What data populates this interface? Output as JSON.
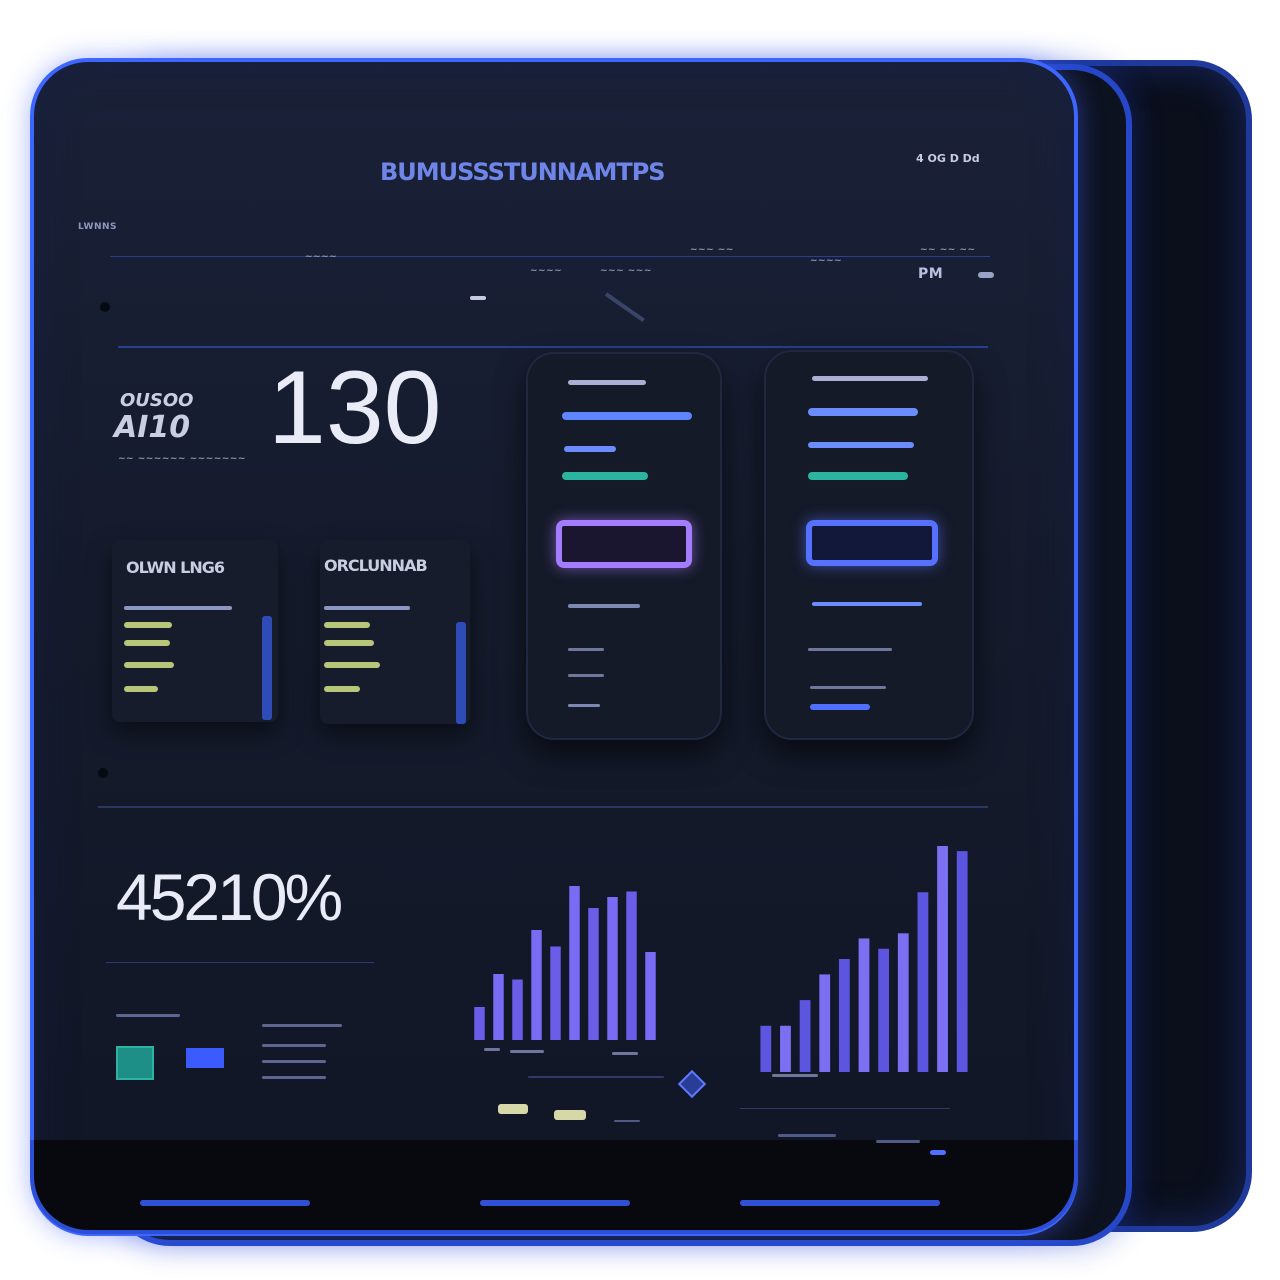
{
  "app": {
    "title": "BUMUSSSTUNNAMTPS",
    "top_right_status": "4 OG D Dd"
  },
  "header": {
    "corner_label": "LWNNS",
    "small_labels": [
      "~~~~",
      "~~~ ~~",
      "~~ ~~ ~~",
      "~~~~",
      "~~~ ~~~",
      "~~~~"
    ],
    "indicator": "PM"
  },
  "stats": {
    "mini_top": "OUSOO",
    "mini_value": "AI10",
    "mini_caption": "~~ ~~~~~~     ~~~~~~~",
    "main_value": "130",
    "percent_value": "45210%"
  },
  "panels": [
    {
      "title": "OLWN LNG6"
    },
    {
      "title": "ORCLUNNAB"
    }
  ],
  "chart_data": [
    {
      "type": "bar",
      "values": [
        30,
        60,
        55,
        100,
        85,
        140,
        120,
        130,
        135,
        80
      ],
      "colors": {
        "bar": "#6c5de8",
        "bar_alt": "#7a6bf5"
      }
    },
    {
      "type": "bar",
      "values": [
        45,
        45,
        70,
        95,
        110,
        130,
        120,
        135,
        175,
        220,
        215
      ],
      "colors": {
        "bar": "#5b55e0",
        "bar_alt": "#7d6ff2"
      }
    }
  ],
  "colors": {
    "screen_border": "#3d66ff",
    "accent_teal": "#2bb5a0",
    "accent_purple": "#a67cff",
    "accent_blue": "#5670ff",
    "accent_yellow": "#b8c67a"
  },
  "icons": [
    "diamond-icon",
    "toggle-icon",
    "slider-icon"
  ]
}
